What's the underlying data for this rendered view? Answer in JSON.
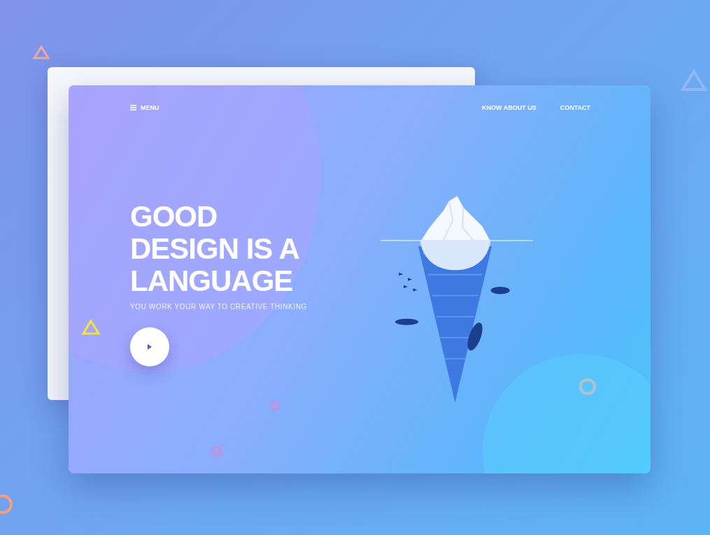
{
  "nav": {
    "menu_label": "MENU",
    "links": [
      "KNOW ABOUT US",
      "CONTACT"
    ]
  },
  "hero": {
    "title_lines": [
      "GOOD",
      "DESIGN IS A",
      "LANGUAGE"
    ],
    "subtitle": "YOU WORK YOUR WAY TO CREATIVE THINKING"
  }
}
